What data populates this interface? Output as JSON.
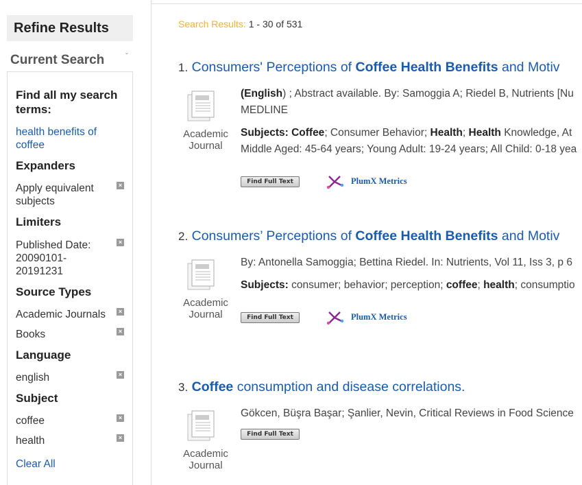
{
  "sidebar": {
    "refine_title": "Refine Results",
    "current_search_label": "Current Search",
    "find_terms_heading": "Find all my search terms:",
    "search_terms_line1": "health benefits of",
    "search_terms_line2": "coffee",
    "expanders_heading": "Expanders",
    "expander_line1": "Apply equivalent",
    "expander_line2": "subjects",
    "limiters_heading": "Limiters",
    "limiter_line1": "Published Date:",
    "limiter_line2": "20090101-",
    "limiter_line3": "20191231",
    "source_types_heading": "Source Types",
    "source_type_1": "Academic Journals",
    "source_type_2": "Books",
    "language_heading": "Language",
    "language_value": "english",
    "subject_heading": "Subject",
    "subject_1": "coffee",
    "subject_2": "health",
    "clear_all": "Clear All",
    "remove_glyph": "×"
  },
  "results_header": {
    "label": "Search Results:",
    "count": "1 - 30 of 531"
  },
  "results": [
    {
      "num": "1.",
      "title_parts": [
        "Consumers' Perceptions of ",
        "Coffee Health Benefits",
        " and Motiv"
      ],
      "doc_type_line1": "Academic",
      "doc_type_line2": "Journal",
      "line1_bold": "(English",
      "line1_rest": ") ; Abstract available. By: Samoggia A; Riedel B, Nutrients [Nu",
      "line2": "MEDLINE",
      "subjects_label": "Subjects:",
      "subj_a_bold": "Coffee",
      "subj_b": "; Consumer Behavior; ",
      "subj_c_bold": "Health",
      "subj_d": "; ",
      "subj_e_bold": "Health",
      "subj_f": " Knowledge, At",
      "line4": "Middle Aged: 45-64 years; Young Adult: 19-24 years; All Child: 0-18 yea",
      "full_text_label": "Find Full Text",
      "plumx_label": "PlumX Metrics"
    },
    {
      "num": "2.",
      "title_parts": [
        "Consumers’ Perceptions of ",
        "Coffee Health Benefits",
        " and Motiv"
      ],
      "doc_type_line1": "Academic",
      "doc_type_line2": "Journal",
      "line1": "By: Antonella Samoggia; Bettina Riedel. In: Nutrients, Vol 11, Iss 3, p 6",
      "subjects_label": "Subjects:",
      "subj_a": " consumer; behavior; perception; ",
      "subj_b_bold": "coffee",
      "subj_c": "; ",
      "subj_d_bold": "health",
      "subj_e": "; consumptio",
      "full_text_label": "Find Full Text",
      "plumx_label": "PlumX Metrics"
    },
    {
      "num": "3.",
      "title_bold": "Coffee",
      "title_rest": " consumption and disease correlations.",
      "doc_type_line1": "Academic",
      "doc_type_line2": "Journal",
      "line1": "Gökcen, Büşra Başar; Şanlier, Nevin, Critical Reviews in Food Science",
      "full_text_label": "Find Full Text"
    }
  ],
  "colors": {
    "link": "#1b5bab",
    "accent_label": "#f3b22d",
    "plumx_purple": "#8b2a8f"
  }
}
